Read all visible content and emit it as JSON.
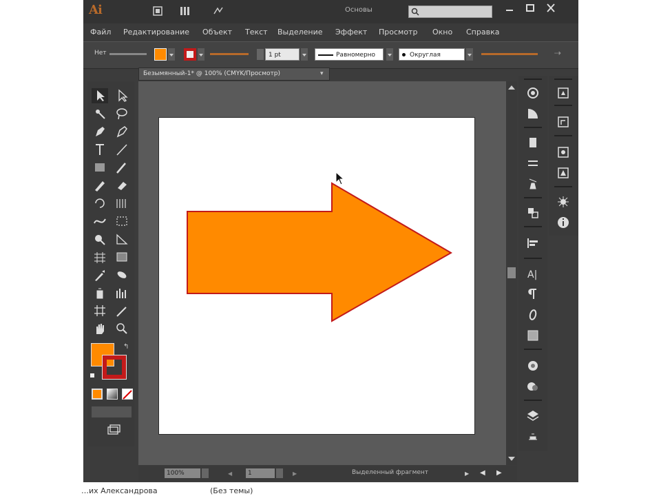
{
  "app": {
    "logo": "Ai",
    "workspace": "Основы"
  },
  "menu": [
    "Файл",
    "Редактирование",
    "Объект",
    "Текст",
    "Выделение",
    "Эффект",
    "Просмотр",
    "Окно",
    "Справка"
  ],
  "control": {
    "selection_label": "Нет",
    "stroke_weight": "1 pt",
    "profile": "Равномерно",
    "brush": "Округлая",
    "fill_color": "#ff8a00",
    "stroke_color": "#c21a1a"
  },
  "document": {
    "tab_title": "Безымянный-1* @ 100% (CMYK/Просмотр)"
  },
  "status": {
    "zoom": "100%",
    "page": "1",
    "mode": "Выделенный фрагмент"
  },
  "shape": {
    "fill": "#ff8a00",
    "stroke": "#c21a1a"
  },
  "caption": {
    "author": "…их Александрова",
    "tag": "(Без темы)"
  }
}
